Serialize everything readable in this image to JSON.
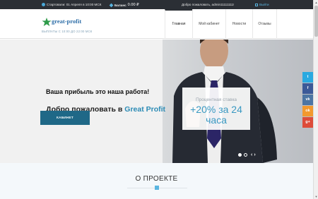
{
  "topbar": {
    "start_text": "Стартовали: 01 Апреля в 10:00 МСК",
    "balance_label": "Баланс",
    "balance_value": "0.00 ₽",
    "welcome_user": "Добро пожаловать, admin11111111!",
    "exit_label": "Выйти"
  },
  "header": {
    "logo_text": "great-profit",
    "logo_subtitle": "ВЫПЛАТЫ С 10:00 ДО 22:00 МСК",
    "nav": [
      {
        "label": "Главная"
      },
      {
        "label": "Мой кабинет"
      },
      {
        "label": "Новости"
      },
      {
        "label": "Отзывы"
      }
    ]
  },
  "hero": {
    "welcome_prefix": "Добро пожаловать в",
    "welcome_brand": "Great Profit",
    "tagline": "Ваша прибыль это наша работа!",
    "cabinet_button": "КАБИНЕТ",
    "rate_label": "Процентная ставка",
    "rate_value": "+20% за 24 часа"
  },
  "social": [
    {
      "icon": "twitter-icon",
      "glyph": "t",
      "color": "#2aa9e0"
    },
    {
      "icon": "facebook-icon",
      "glyph": "f",
      "color": "#3b5998"
    },
    {
      "icon": "vk-icon",
      "glyph": "vk",
      "color": "#4c75a3"
    },
    {
      "icon": "odnoklassniki-icon",
      "glyph": "ok",
      "color": "#f2992e"
    },
    {
      "icon": "google-plus-icon",
      "glyph": "g+",
      "color": "#dd4b39"
    }
  ],
  "section": {
    "title": "О ПРОЕКТЕ"
  },
  "colors": {
    "accent": "#2b8bb5",
    "dark_bar": "#2b2f35",
    "button": "#1f6887"
  }
}
